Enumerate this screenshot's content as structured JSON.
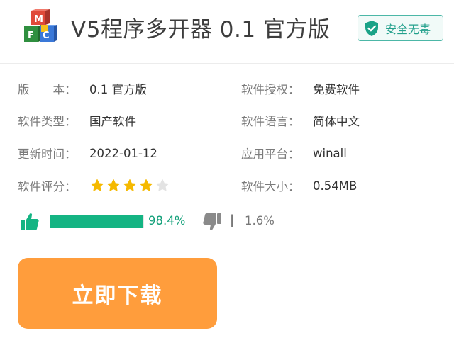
{
  "header": {
    "title": "V5程序多开器  0.1 官方版",
    "safe_badge": "安全无毒",
    "logo_letters": [
      "M",
      "F",
      "C"
    ],
    "logo_icon": "color-cubes-logo",
    "safe_icon": "shield-check-icon"
  },
  "info": {
    "version": {
      "label": "版　　本：",
      "value": "0.1 官方版"
    },
    "license": {
      "label": "软件授权：",
      "value": "免费软件"
    },
    "type": {
      "label": "软件类型：",
      "value": "国产软件"
    },
    "language": {
      "label": "软件语言：",
      "value": "简体中文"
    },
    "updated": {
      "label": "更新时间：",
      "value": "2022-01-12"
    },
    "platform": {
      "label": "应用平台：",
      "value": "winall"
    },
    "score": {
      "label": "软件评分：",
      "stars_filled": 4,
      "stars_total": 5
    },
    "size": {
      "label": "软件大小：",
      "value": "0.54MB"
    }
  },
  "rating": {
    "up_percent": "98.4%",
    "up_fraction": 0.984,
    "separator": "|",
    "down_percent": "1.6%"
  },
  "download": {
    "label": "立即下载"
  },
  "colors": {
    "accent_green": "#14b483",
    "badge_green": "#23a08c",
    "button_orange": "#ff9d3c",
    "star_gold": "#f5b900"
  }
}
